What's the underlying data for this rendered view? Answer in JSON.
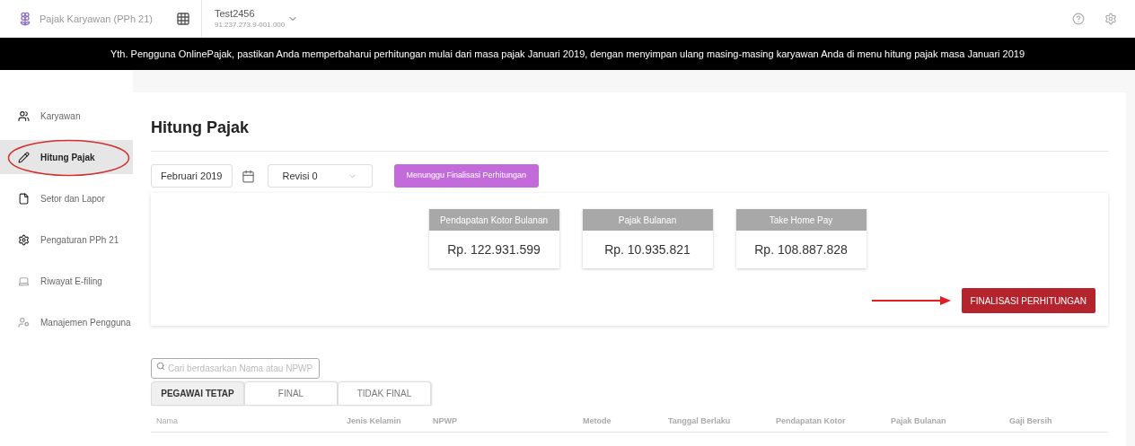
{
  "header": {
    "app_name": "Pajak Karyawan (PPh 21)",
    "company": "Test2456",
    "npwp": "91.237.273.9-001.000"
  },
  "banner": "Yth. Pengguna OnlinePajak, pastikan Anda memperbaharui perhitungan mulai dari masa pajak Januari 2019, dengan menyimpan ulang masing-masing karyawan Anda di menu hitung pajak masa Januari 2019",
  "sidebar": {
    "items": [
      {
        "label": "Karyawan",
        "selected": false
      },
      {
        "label": "Hitung Pajak",
        "selected": true
      },
      {
        "label": "Setor dan Lapor",
        "selected": false
      },
      {
        "label": "Pengaturan PPh 21",
        "selected": false
      },
      {
        "label": "Riwayat E-filing",
        "selected": false
      },
      {
        "label": "Manajemen Pengguna",
        "selected": false
      }
    ]
  },
  "page_title": "Hitung Pajak",
  "period": "Februari 2019",
  "revision": "Revisi 0",
  "status_badge": "Menunggu Finalisasi Perhitungan",
  "summary_cards": [
    {
      "title": "Pendapatan Kotor Bulanan",
      "value": "Rp. 122.931.599"
    },
    {
      "title": "Pajak Bulanan",
      "value": "Rp. 10.935.821"
    },
    {
      "title": "Take Home Pay",
      "value": "Rp. 108.887.828"
    }
  ],
  "finalize_button": "FINALISASI PERHITUNGAN",
  "search": {
    "placeholder": "Cari berdasarkan Nama atau NPWP"
  },
  "tabs": [
    {
      "label": "PEGAWAI TETAP",
      "selected": true
    },
    {
      "label": "FINAL",
      "selected": false
    },
    {
      "label": "TIDAK FINAL",
      "selected": false
    }
  ],
  "table": {
    "columns": [
      "Nama",
      "Jenis Kelamin",
      "NPWP",
      "Metode",
      "Tanggal Berlaku",
      "Pendapatan Kotor",
      "Pajak Bulanan",
      "Gaji Bersih"
    ]
  }
}
